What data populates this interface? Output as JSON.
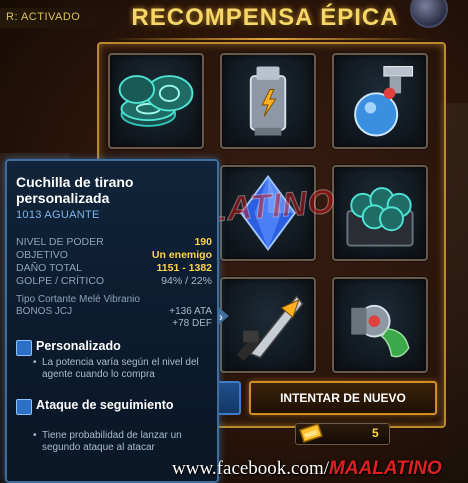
{
  "status_text": "R: ACTIVADO",
  "title": "RECOMPENSA ÉPICA",
  "rewards": [
    {
      "icon": "coin-stack-icon"
    },
    {
      "icon": "energy-canister-icon"
    },
    {
      "icon": "potion-flask-icon"
    },
    {
      "icon": "energy-crystal-icon"
    },
    {
      "icon": "coin-chest-icon"
    },
    {
      "icon": "tyrant-blade-icon"
    },
    {
      "icon": "gadget-claw-icon"
    }
  ],
  "tooltip": {
    "item_name": "Cuchilla de tirano personalizada",
    "durability": "1013 AGUANTE",
    "stats": [
      {
        "label": "NIVEL DE PODER",
        "value": "190"
      },
      {
        "label": "OBJETIVO",
        "value": "Un enemigo"
      },
      {
        "label": "DAÑO TOTAL",
        "value": "1151 - 1382"
      },
      {
        "label": "GOLPE / CRÍTICO",
        "value": "94% / 22%"
      }
    ],
    "type_line": "Tipo  Cortante Melé Vibranio",
    "bonus_label": "BONOS JCJ",
    "bonus_values": [
      "+136 ATA",
      "+78 DEF"
    ],
    "traits": [
      {
        "title": "Personalizado",
        "desc": "La potencia varía según el nivel del agente cuando lo compra",
        "icon": "customize-icon"
      },
      {
        "title": "Ataque de seguimiento",
        "desc": "Tiene probabilidad de lanzar un segundo ataque al atacar",
        "icon": "follow-up-attack-icon"
      }
    ]
  },
  "retry_button": "INTENTAR DE NUEVO",
  "cost": {
    "value": "5",
    "icon": "gold-bar-icon"
  },
  "watermark": "MAALATINO",
  "footer": {
    "link_prefix": "www.facebook.com/",
    "link_brand": "MAALATINO"
  },
  "colors": {
    "title_gold": "#f7d668",
    "panel_border": "#b8892f",
    "tooltip_border": "#3f6e9c",
    "stat_value": "#ffd24a"
  }
}
